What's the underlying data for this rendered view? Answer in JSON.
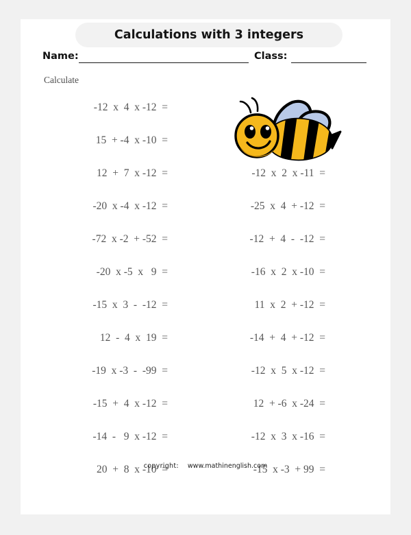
{
  "worksheet": {
    "title": "Calculations with 3 integers",
    "name_label": "Name:",
    "class_label": "Class:",
    "instruction": "Calculate",
    "copyright_label": "copyright:",
    "website": "www.mathinenglish.com",
    "illustration": "bee-illustration"
  },
  "colors": {
    "page_background": "#f1f1f1",
    "sheet": "#ffffff",
    "title_pill": "#f2f2f2",
    "title_text": "#151515",
    "problem_text": "#555555",
    "equals_sign": "#8c8c8c",
    "instruction_text": "#4d4d4d",
    "rule_line": "#1a1a1a",
    "bee_yellow": "#f5b81c",
    "bee_black": "#000000",
    "bee_wing": "#b8c9e8",
    "bee_yellow_shadow": "#d99a10"
  },
  "problems": {
    "rows": [
      {
        "left": "-12  x  4  x -12  =",
        "right": ""
      },
      {
        "left": "15  + -4  x -10  =",
        "right": ""
      },
      {
        "left": "12  +  7  x -12  =",
        "right": "-12  x  2  x -11  ="
      },
      {
        "left": "-20  x -4  x -12  =",
        "right": "-25  x  4  + -12  ="
      },
      {
        "left": "-72  x -2  + -52  =",
        "right": "-12  +  4  -  -12  ="
      },
      {
        "left": "-20  x -5  x   9  =",
        "right": "-16  x  2  x -10  ="
      },
      {
        "left": "-15  x  3  -  -12  =",
        "right": "11  x  2  + -12  ="
      },
      {
        "left": "12  -  4  x  19  =",
        "right": "-14  +  4  + -12  ="
      },
      {
        "left": "-19  x -3  -  -99  =",
        "right": "-12  x  5  x -12  ="
      },
      {
        "left": "-15  +  4  x -12  =",
        "right": "12  + -6  x -24  ="
      },
      {
        "left": "-14  -   9  x -12  =",
        "right": "-12  x  3  x -16  ="
      },
      {
        "left": "20  +  8  x -10  =",
        "right": "-15  x -3  + 99  ="
      }
    ]
  }
}
